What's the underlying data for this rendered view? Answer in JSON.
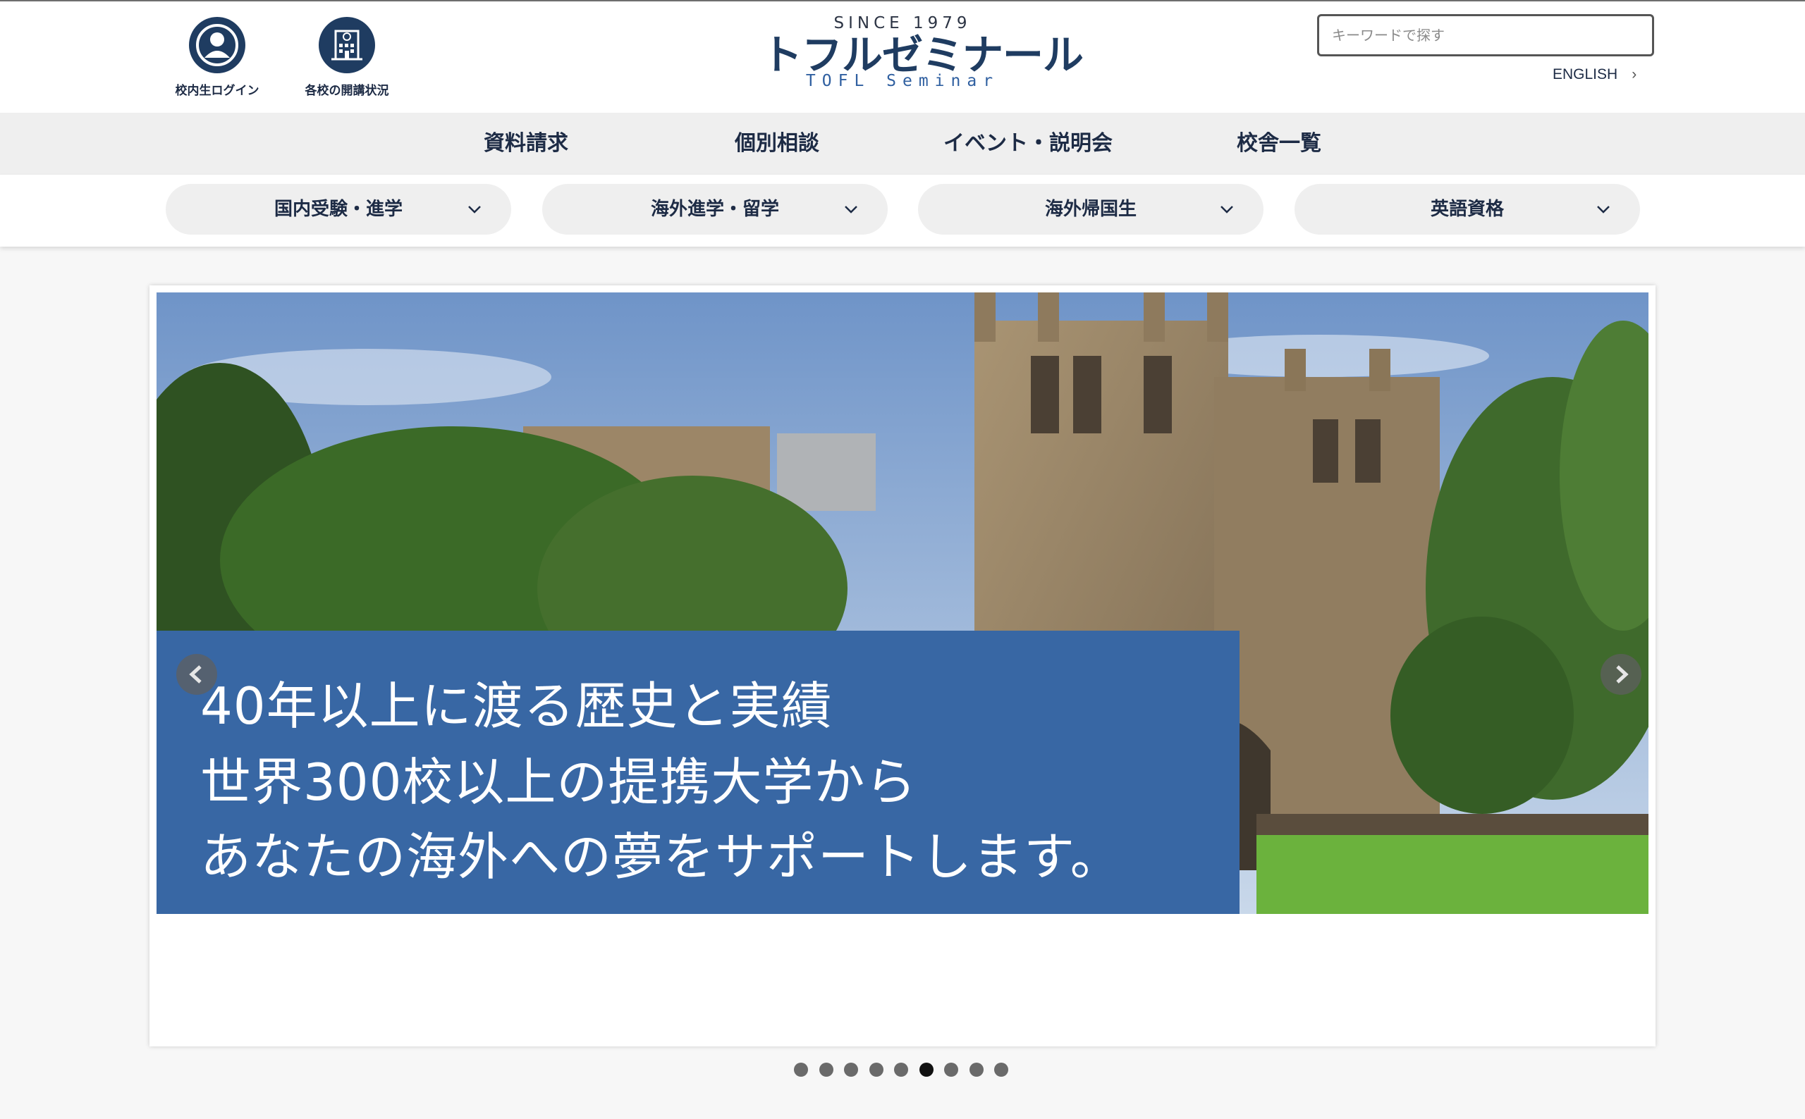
{
  "header": {
    "quick_links": [
      {
        "label": "校内生ログイン",
        "icon": "user-icon"
      },
      {
        "label": "各校の開講状況",
        "icon": "building-icon"
      }
    ],
    "logo": {
      "since": "SINCE 1979",
      "name": "トフルゼミナール",
      "name_en": "TOFL Seminar"
    },
    "search": {
      "placeholder": "キーワードで探す",
      "value": ""
    },
    "language_link": "ENGLISH"
  },
  "nav": {
    "items": [
      "資料請求",
      "個別相談",
      "イベント・説明会",
      "校舎一覧"
    ]
  },
  "categories": [
    {
      "label": "国内受験・進学",
      "icon": "chevron-down-icon"
    },
    {
      "label": "海外進学・留学",
      "icon": "chevron-down-icon"
    },
    {
      "label": "海外帰国生",
      "icon": "chevron-down-icon"
    },
    {
      "label": "英語資格",
      "icon": "chevron-down-icon"
    }
  ],
  "carousel": {
    "caption_lines": [
      "40年以上に渡る歴史と実績",
      "世界300校以上の提携大学から",
      "あなたの海外への夢をサポートします。"
    ],
    "slide_count": 9,
    "active_slide": 6,
    "caption_color": "#3867a4"
  },
  "colors": {
    "brand": "#1f3c61",
    "nav_bg": "#efefef"
  }
}
